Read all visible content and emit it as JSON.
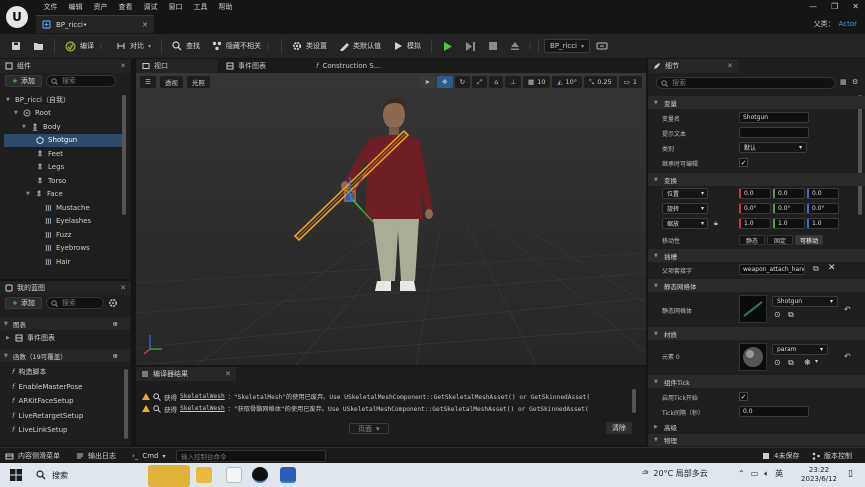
{
  "app": {
    "logo": "unreal-logo",
    "menu": [
      "文件",
      "编辑",
      "资产",
      "查看",
      "调试",
      "窗口",
      "工具",
      "帮助"
    ],
    "doc_tab": "BP_ricci•",
    "parent_label": "父类：",
    "parent_value": "Actor"
  },
  "toolbar": {
    "compile": "编译",
    "diff": "对比",
    "find": "查找",
    "hide_unrelated": "隐藏不相关",
    "class_settings": "类设置",
    "class_defaults": "类默认值",
    "simulate": "模拟",
    "debug_object": "BP_ricci"
  },
  "components_panel": {
    "tab": "组件",
    "add": "添加",
    "search_placeholder": "搜索",
    "items": [
      {
        "label": "BP_ricci（自我）",
        "indent": 0
      },
      {
        "label": "Root",
        "indent": 1
      },
      {
        "label": "Body",
        "indent": 2
      },
      {
        "label": "Shotgun",
        "indent": 3,
        "selected": true
      },
      {
        "label": "Feet",
        "indent": 3
      },
      {
        "label": "Legs",
        "indent": 3
      },
      {
        "label": "Torso",
        "indent": 3
      },
      {
        "label": "Face",
        "indent": 3
      },
      {
        "label": "Mustache",
        "indent": 4
      },
      {
        "label": "Eyelashes",
        "indent": 4
      },
      {
        "label": "Fuzz",
        "indent": 4
      },
      {
        "label": "Eyebrows",
        "indent": 4
      },
      {
        "label": "Hair",
        "indent": 4
      }
    ]
  },
  "my_blueprint": {
    "tab": "我的蓝图",
    "add": "添加",
    "search_placeholder": "搜索",
    "graphs": "图表",
    "event_graph": "事件图表",
    "functions_header": "函数（19可覆盖）",
    "functions": [
      "构造脚本",
      "EnableMasterPose",
      "ARKitFaceSetup",
      "LiveRetargetSetup",
      "LiveLinkSetup"
    ]
  },
  "editor_tabs": [
    "视口",
    "事件图表",
    "Construction S..."
  ],
  "viewport": {
    "perspective": "透视",
    "lit": "光照",
    "grid_snap": "10",
    "rot_snap": "10°",
    "scale_snap": "0.25",
    "cam_speed": "1"
  },
  "compiler": {
    "tab": "编译器结果",
    "lines": [
      {
        "pre": "获得",
        "code": "SkeletalWesh",
        "rest": "：\"SkeletalMesh\"的使用已废弃。Use USkeletalMeshComponent::GetSkeletalMeshAsset() or GetSkinnedAsset("
      },
      {
        "pre": "获得",
        "code": "SkeletalWesh",
        "rest": "：\"获取骨骼网格体\"的使用已废弃。Use USkeletalMeshComponent::GetSkeletalMeshAsset() or GetSkinnedAsset("
      }
    ],
    "page_button": "页面",
    "clear": "清除"
  },
  "details": {
    "tab": "细节",
    "search_placeholder": "搜索",
    "sections": {
      "variable": "变量",
      "transform": "变换",
      "sockets": "插槽",
      "static_mesh": "静态网格体",
      "materials": "材质",
      "component_tick": "组件Tick",
      "advanced": "高级",
      "physics": "物理"
    },
    "variable_name_label": "变量名",
    "variable_name": "Shotgun",
    "tooltip_label": "提示文本",
    "category_label": "类别",
    "category_value": "默认",
    "editable_label": "继承时可编辑",
    "location_label": "位置",
    "rotation_label": "旋转",
    "scale_label": "缩放",
    "location": [
      "0.0",
      "0.0",
      "0.0"
    ],
    "rotation": [
      "0.0°",
      "0.0°",
      "0.0°"
    ],
    "scale": [
      "1.0",
      "1.0",
      "1.0"
    ],
    "mobility_label": "移动性",
    "mobility": [
      "静态",
      "固定",
      "可移动"
    ],
    "parent_socket_label": "父项套接字",
    "parent_socket": "weapon_attach_hand_r",
    "static_mesh_label": "静态网格体",
    "static_mesh_value": "Shotgun",
    "element_label": "元素 0",
    "material_value": "param",
    "tick_enabled_label": "启用Tick开始",
    "tick_interval_label": "Tick间隔（秒）",
    "tick_interval": "0.0"
  },
  "statusbar": {
    "content_drawer": "内容侧滑菜单",
    "output_log": "输出日志",
    "cmd": "Cmd",
    "console_placeholder": "输入控制台命令",
    "unsaved": "4未保存",
    "source_control": "版本控制"
  },
  "taskbar": {
    "search": "搜索",
    "weather": "20°C  局部多云",
    "lang": "英",
    "time": "23:22",
    "date": "2023/6/12"
  }
}
